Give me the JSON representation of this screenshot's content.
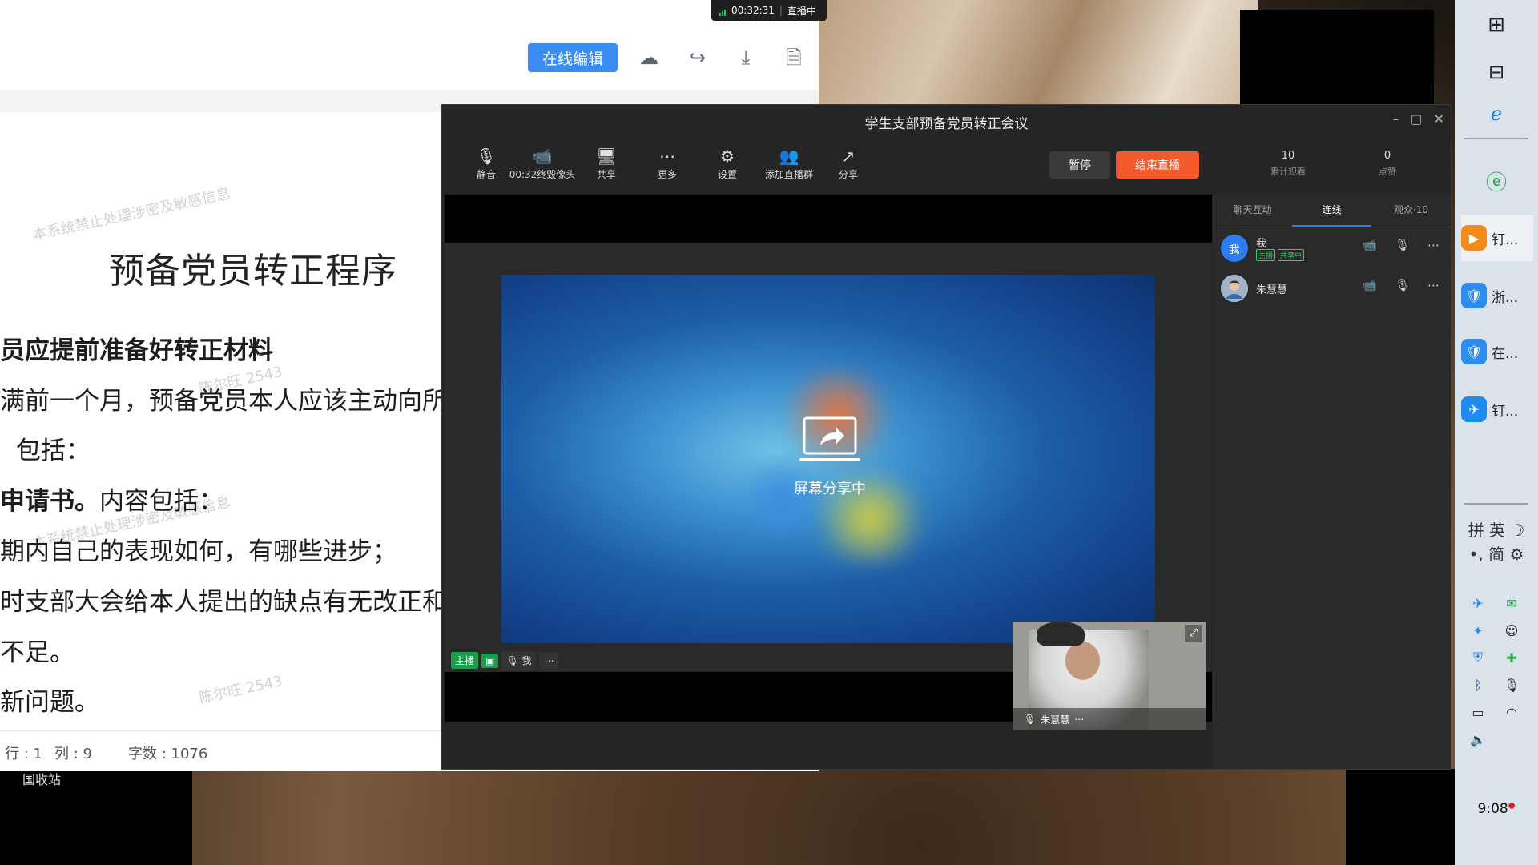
{
  "document": {
    "edit_button": "在线编辑",
    "title": "预备党员转正程序",
    "lines": [
      "员应提前准备好转正材料",
      "满前一个月，预备党员本人应该主动向所",
      "包括：",
      "申请书。",
      "内容包括：",
      "期内自己的表现如何，有哪些进步；",
      "时支部大会给本人提出的缺点有无改正和",
      "不足。",
      "新问题。"
    ],
    "watermarks": [
      "本系统禁止处理涉密及敏感信息",
      "陈尔旺 2543",
      "本系统禁止处理涉密及敏感信息",
      "陈尔旺 2543"
    ],
    "status": {
      "row": "行 : 1",
      "col": "列 : 9",
      "chars": "字数 : 1076"
    },
    "footer_cut": "国收站"
  },
  "recording": {
    "time": "00:32:31",
    "label": "直播中"
  },
  "meeting": {
    "title": "学生支部预备党员转正会议",
    "tools": [
      {
        "icon": "microphone-icon",
        "glyph": "🎙",
        "label": "静音"
      },
      {
        "icon": "camera-icon",
        "glyph": "📹",
        "label": "00:32终毁像头"
      },
      {
        "icon": "share-screen-icon",
        "glyph": "🖥",
        "label": "共享"
      },
      {
        "icon": "more-icon",
        "glyph": "⋯",
        "label": "更多"
      },
      {
        "icon": "settings-icon",
        "glyph": "⚙",
        "label": "设置"
      },
      {
        "icon": "add-group-icon",
        "glyph": "👥",
        "label": "添加直播群"
      },
      {
        "icon": "share-link-icon",
        "glyph": "↗",
        "label": "分享"
      }
    ],
    "pause": "暂停",
    "end_live": "结束直播",
    "stats": [
      {
        "value": "10",
        "label": "累计观看"
      },
      {
        "value": "0",
        "label": "点赞"
      }
    ],
    "stage": {
      "sharing_label": "屏幕分享中",
      "host_tag": "主播",
      "me_label": "我",
      "pip_name": "朱慧慧"
    },
    "panel": {
      "tabs": [
        "聊天互动",
        "连线",
        "观众·10"
      ],
      "active_tab": 1,
      "participants": [
        {
          "avatar": "我",
          "name": "我",
          "badges": [
            "主播",
            "共享中"
          ],
          "avatar_color": "#2c7ef0"
        },
        {
          "avatar": "",
          "name": "朱慧慧",
          "badges": [],
          "avatar_color": "#b9c7d6"
        }
      ]
    }
  },
  "taskbar": {
    "apps": [
      {
        "label": "钉...",
        "color": "#f28a1c",
        "glyph": "▶"
      },
      {
        "label": "浙...",
        "color": "#2d8cf0",
        "glyph": "🛡"
      },
      {
        "label": "在...",
        "color": "#2d8cf0",
        "glyph": "🛡"
      },
      {
        "label": "钉...",
        "color": "#1f8af0",
        "glyph": "✈"
      }
    ],
    "ime_top": "拼 英 ☽",
    "ime_bottom": "•, 简 ⚙",
    "clock": "9:08"
  }
}
